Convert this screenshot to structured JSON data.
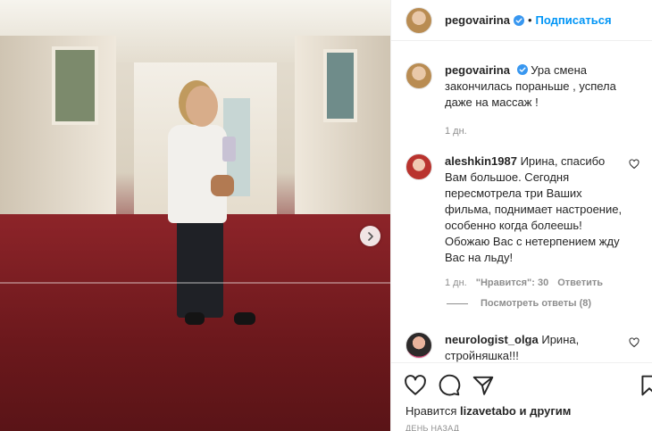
{
  "post": {
    "author": "pegovairina",
    "follow_label": "Подписаться",
    "separator": "•"
  },
  "caption": {
    "author": "pegovairina",
    "text": "Ура смена закончилась пораньше , успела даже на массаж !",
    "time": "1 дн."
  },
  "comments": [
    {
      "author": "aleshkin1987",
      "text": "Ирина, спасибо Вам большое. Сегодня пересмотрела три Ваших фильма, поднимает настроение, особенно когда болеешь! Обожаю Вас с нетерпением жду Вас на льду!",
      "time": "1 дн.",
      "likes": "\"Нравится\": 30",
      "reply_label": "Ответить",
      "view_replies": "Посмотреть ответы (8)"
    },
    {
      "author": "neurologist_olga",
      "text": "Ирина, стройняшка!!!"
    }
  ],
  "footer": {
    "likes_prefix": "Нравится",
    "liked_by": "lizavetabo",
    "likes_suffix": "и другим",
    "time": "ДЕНЬ НАЗАД"
  },
  "icons": {
    "like": "heart-icon",
    "comment": "comment-icon",
    "share": "share-icon",
    "save": "bookmark-icon",
    "next": "chevron-right-icon",
    "verified": "verified-badge-icon"
  },
  "colors": {
    "accent": "#0095f6",
    "text": "#262626",
    "muted": "#8e8e8e"
  }
}
